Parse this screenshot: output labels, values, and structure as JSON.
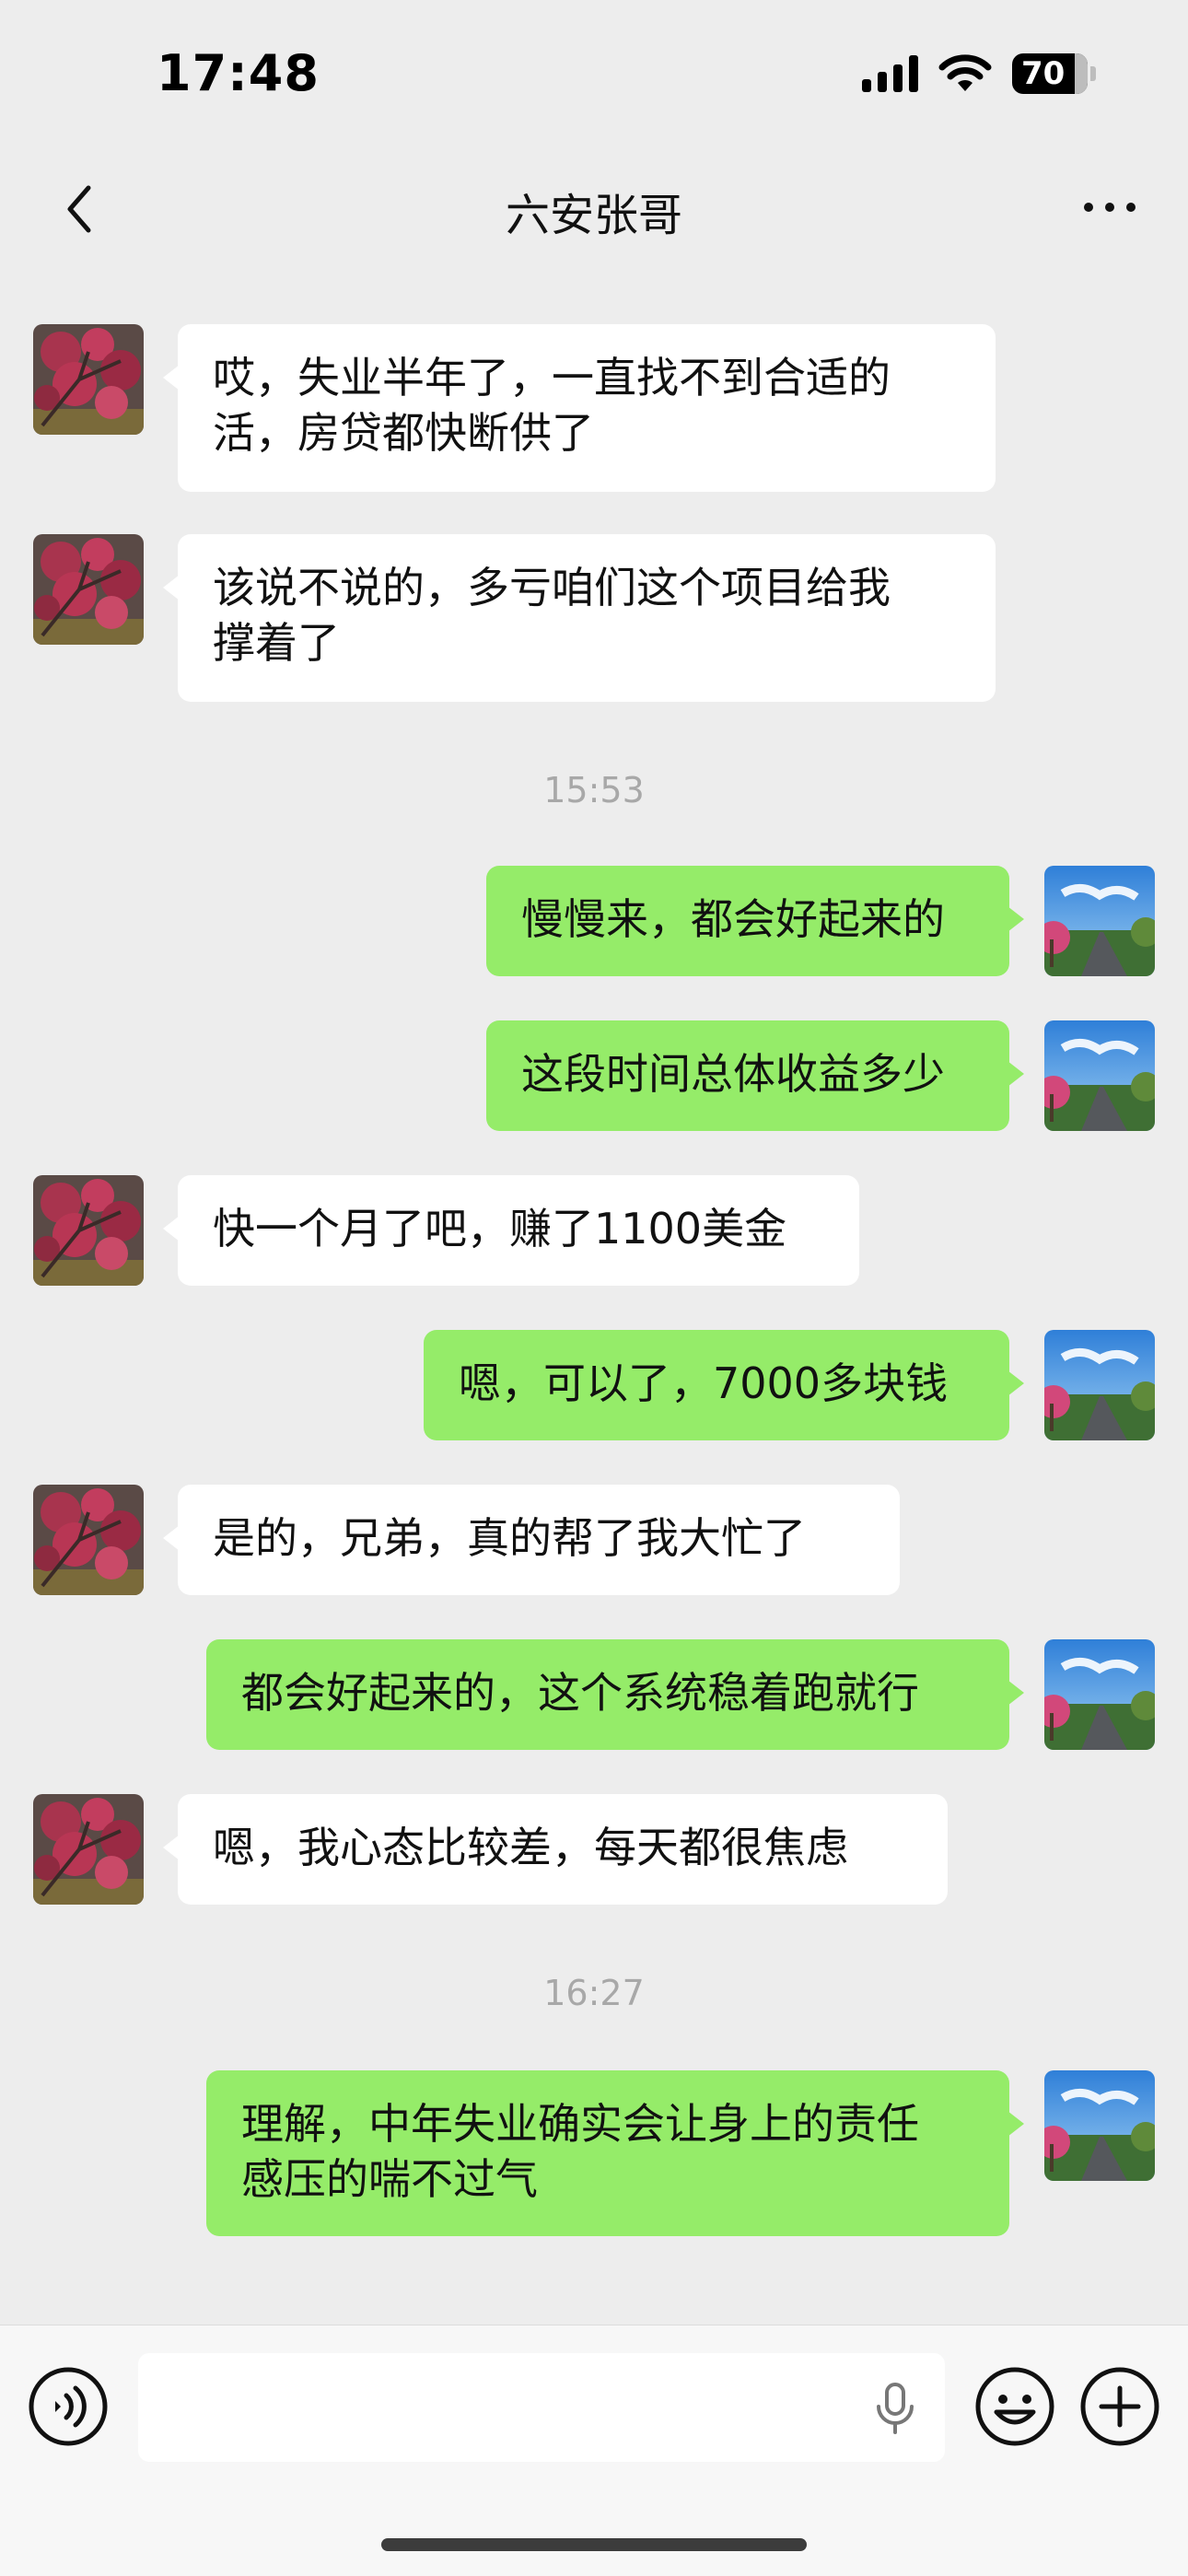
{
  "status": {
    "time": "17:48",
    "battery": "70"
  },
  "header": {
    "title": "六安张哥"
  },
  "messages": [
    {
      "dir": "in",
      "text": "哎，失业半年了，一直找不到合适的\n活，房贷都快断供了"
    },
    {
      "dir": "in",
      "text": "该说不说的，多亏咱们这个项目给我\n撑着了"
    },
    {
      "dir": "time",
      "text": "15:53"
    },
    {
      "dir": "out",
      "text": "慢慢来，都会好起来的"
    },
    {
      "dir": "out",
      "text": "这段时间总体收益多少"
    },
    {
      "dir": "in",
      "text": "快一个月了吧，赚了1100美金"
    },
    {
      "dir": "out",
      "text": "嗯，可以了，7000多块钱"
    },
    {
      "dir": "in",
      "text": "是的，兄弟，真的帮了我大忙了"
    },
    {
      "dir": "out",
      "text": "都会好起来的，这个系统稳着跑就行"
    },
    {
      "dir": "in",
      "text": "嗯，我心态比较差，每天都很焦虑"
    },
    {
      "dir": "time",
      "text": "16:27"
    },
    {
      "dir": "out",
      "text": "理解，中年失业确实会让身上的责任\n感压的喘不过气"
    }
  ],
  "input": {
    "placeholder": ""
  },
  "colors": {
    "bubble_out": "#95ec69",
    "bubble_in": "#ffffff",
    "background": "#ededed"
  },
  "icons": [
    "back-icon",
    "more-icon",
    "voice-icon",
    "mic-icon",
    "emoji-icon",
    "plus-icon"
  ]
}
